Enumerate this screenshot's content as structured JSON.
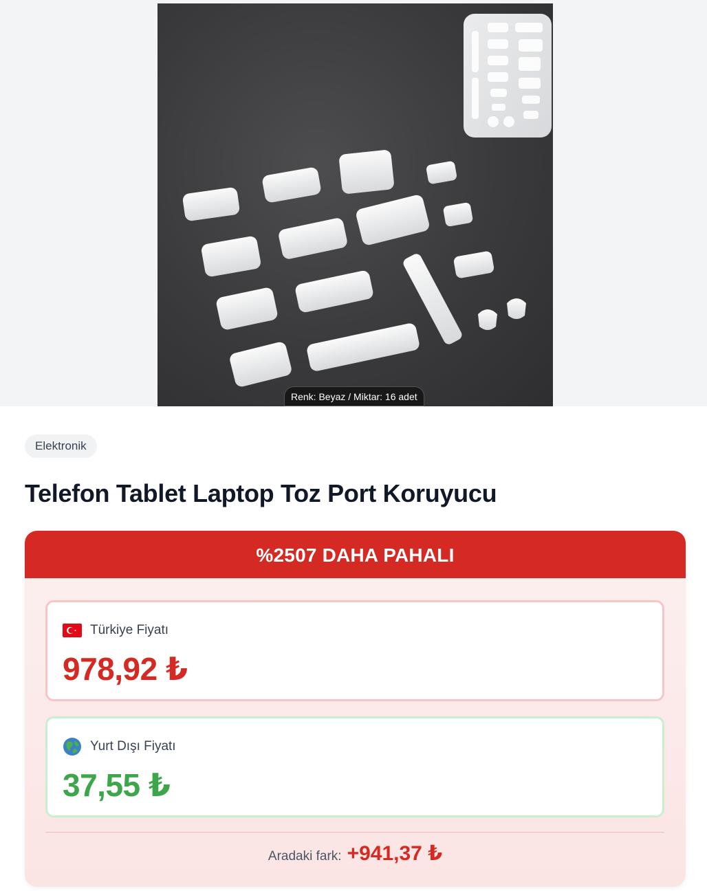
{
  "product": {
    "image_alt": "Silikon toz port koruyucu tıpalar",
    "variant": "Renk: Beyaz / Miktar: 16 adet",
    "category": "Elektronik",
    "title": "Telefon Tablet Laptop Toz Port Koruyucu"
  },
  "comparison": {
    "banner": "%2507 DAHA PAHALI",
    "turkey": {
      "flag": "turkey-flag-icon",
      "label": "Türkiye Fiyatı",
      "price": "978,92 ₺"
    },
    "abroad": {
      "flag": "globe-icon",
      "label": "Yurt Dışı Fiyatı",
      "price": "37,55 ₺"
    },
    "difference_label": "Aradaki fark:",
    "difference_value": "+941,37 ₺"
  },
  "colors": {
    "accent_red": "#d52a23",
    "accent_green": "#3ea64a",
    "card_bg": "#fdf0f0"
  }
}
